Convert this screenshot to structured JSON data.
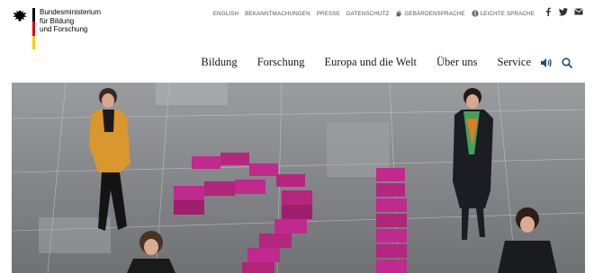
{
  "logo": {
    "ministry_lines": [
      "Bundesministerium",
      "für Bildung",
      "und Forschung"
    ]
  },
  "top_links": [
    {
      "label": "ENGLISH"
    },
    {
      "label": "BEKANNTMACHUNGEN"
    },
    {
      "label": "PRESSE"
    },
    {
      "label": "DATENSCHUTZ"
    },
    {
      "label": "GEBÄRDENSPRACHE",
      "icon": "sign-language-icon"
    },
    {
      "label": "LEICHTE SPRACHE",
      "icon": "easy-language-icon"
    }
  ],
  "social": [
    {
      "icon": "facebook-icon"
    },
    {
      "icon": "twitter-icon"
    },
    {
      "icon": "mail-icon"
    }
  ],
  "main_nav": [
    {
      "label": "Bildung"
    },
    {
      "label": "Forschung"
    },
    {
      "label": "Europa und die Welt"
    },
    {
      "label": "Über uns"
    },
    {
      "label": "Service"
    }
  ],
  "nav_icons": [
    "audio-icon",
    "search-icon"
  ],
  "colors": {
    "flag_black": "#000000",
    "flag_red": "#dd0000",
    "flag_gold": "#ffcc00",
    "nav_icon_blue": "#1f4e79",
    "box_magenta": "#c02a8e"
  }
}
